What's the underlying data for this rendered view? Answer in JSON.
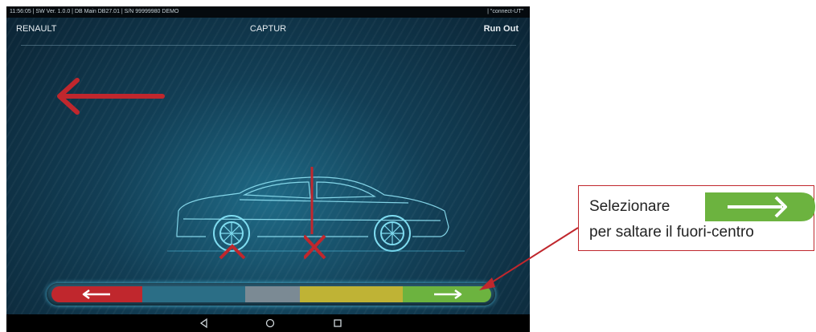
{
  "status_bar": {
    "left": "11:56:05  |  SW Ver. 1.0.0  |  DB Main DB27.01  |  S/N 99999980 DEMO",
    "right": "|  \"connect-UT\""
  },
  "header": {
    "make": "RENAULT",
    "model": "CAPTUR",
    "procedure": "Run Out"
  },
  "bottom_bar": {
    "segments": [
      "back",
      "blue",
      "gray",
      "yellow",
      "next"
    ]
  },
  "android_nav": [
    "back-icon",
    "home-icon",
    "recents-icon"
  ],
  "callout": {
    "line1": "Selezionare",
    "line2": "per saltare il fuori-centro"
  },
  "colors": {
    "red": "#c0272d",
    "green": "#6cb33f",
    "yellow": "#bfb335",
    "gray": "#7b8a94",
    "blue": "#2b6e86"
  }
}
